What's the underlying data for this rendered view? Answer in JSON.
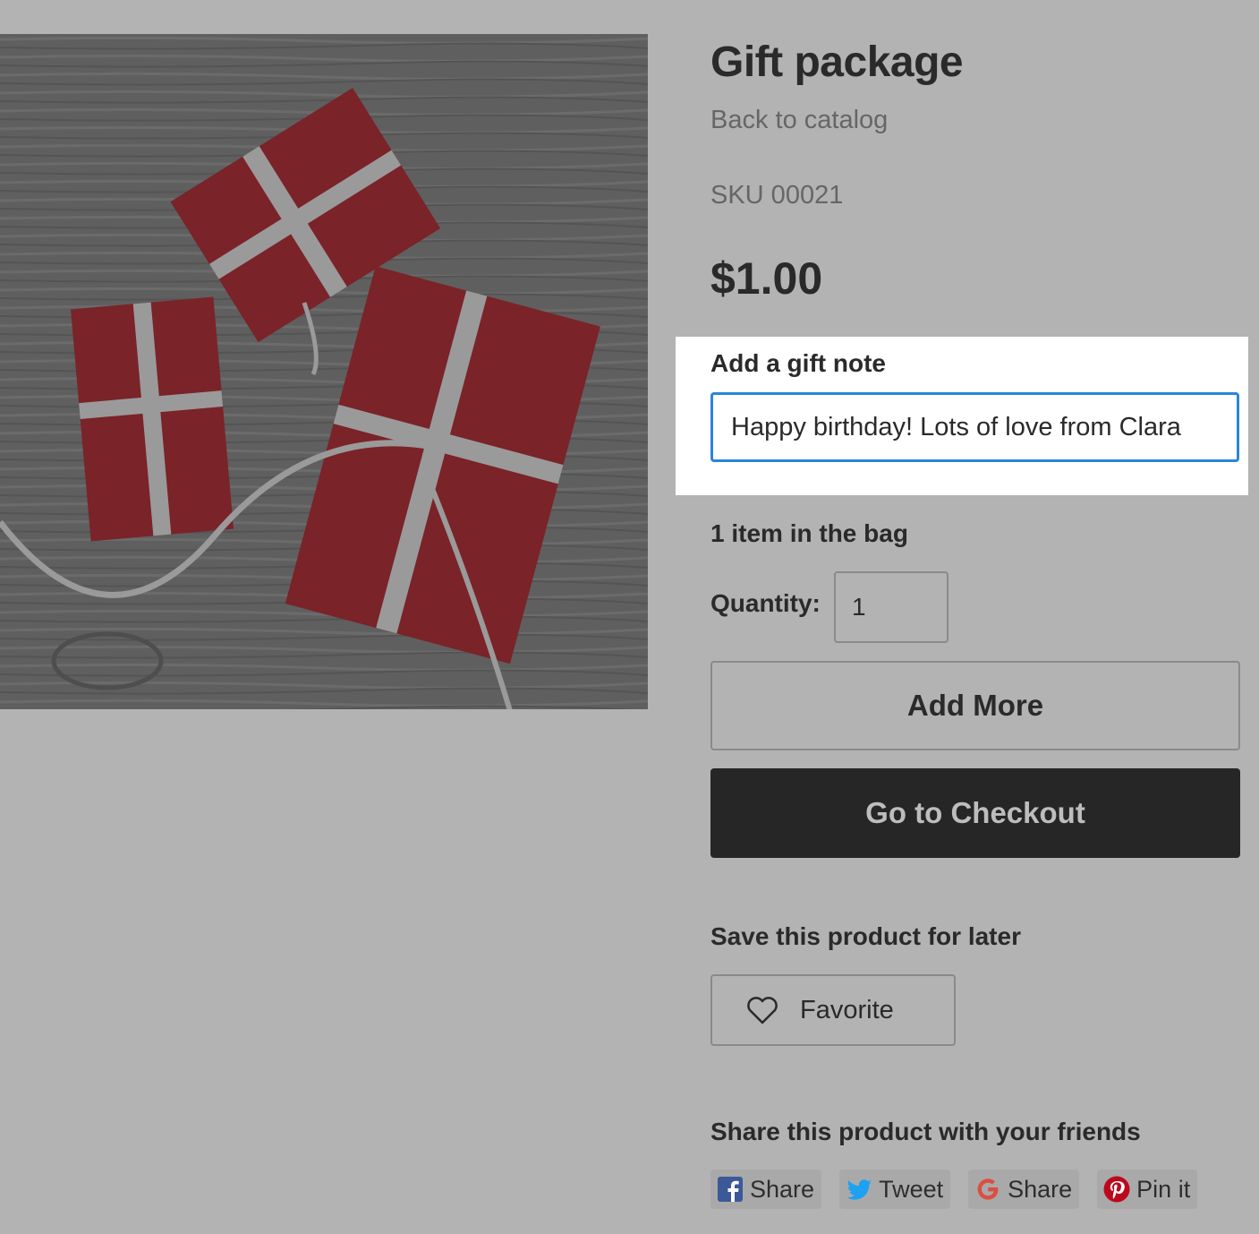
{
  "product": {
    "title": "Gift package",
    "back_link": "Back to catalog",
    "sku": "SKU 00021",
    "price": "$1.00"
  },
  "gift_note": {
    "label": "Add a gift note",
    "value": "Happy birthday! Lots of love from Clara"
  },
  "cart": {
    "bag_count": "1 item in the bag",
    "quantity_label": "Quantity:",
    "quantity_value": "1",
    "add_more_label": "Add More",
    "checkout_label": "Go to Checkout"
  },
  "save": {
    "heading": "Save this product for later",
    "favorite_label": "Favorite",
    "favorite_icon": "heart-icon"
  },
  "share": {
    "heading": "Share this product with your friends",
    "buttons": [
      {
        "icon": "facebook-icon",
        "label": "Share",
        "color": "#3b5998"
      },
      {
        "icon": "twitter-icon",
        "label": "Tweet",
        "color": "#1da1f2"
      },
      {
        "icon": "google-icon",
        "label": "Share",
        "color": "#dc4e41"
      },
      {
        "icon": "pinterest-icon",
        "label": "Pin it",
        "color": "#bd081c"
      }
    ]
  },
  "colors": {
    "overlay_bg": "#b3b3b3",
    "focus_ring": "#2a86d8",
    "checkout_bg": "#262626"
  }
}
